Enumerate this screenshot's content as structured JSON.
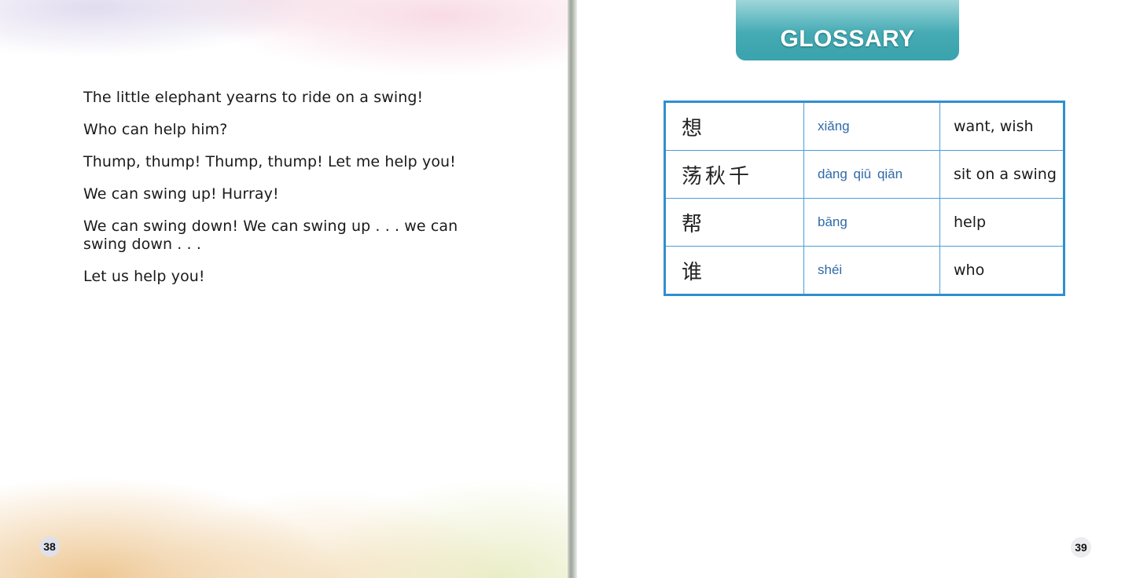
{
  "left_page": {
    "page_number": "38",
    "story_lines": [
      "The little elephant yearns to ride on a swing!",
      "Who can help him?",
      "Thump, thump! Thump, thump! Let me help you!",
      "We can swing up! Hurray!",
      "We can swing down! We can swing up . . . we can swing down . . .",
      "Let us help you!"
    ]
  },
  "right_page": {
    "page_number": "39",
    "glossary_title": "GLOSSARY",
    "glossary": [
      {
        "hanzi": "想",
        "pinyin": "xiǎng",
        "meaning": "want, wish"
      },
      {
        "hanzi": "荡秋千",
        "pinyin": "dàng qiū qiān",
        "meaning": "sit on a swing"
      },
      {
        "hanzi": "帮",
        "pinyin": "bāng",
        "meaning": "help"
      },
      {
        "hanzi": "谁",
        "pinyin": "shéi",
        "meaning": "who"
      }
    ]
  },
  "colors": {
    "banner_teal": "#3aa3ad",
    "table_border": "#2f8fce",
    "pinyin_blue": "#2f6aa8"
  }
}
